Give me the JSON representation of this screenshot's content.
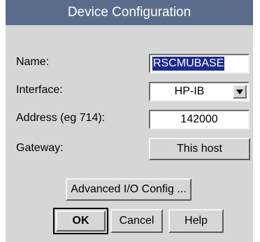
{
  "window": {
    "title": "Device Configuration"
  },
  "form": {
    "name": {
      "label": "Name:",
      "value": "RSCMUBASE"
    },
    "interface": {
      "label": "Interface:",
      "value": "HP-IB"
    },
    "address": {
      "label": "Address (eg 714):",
      "value": "142000"
    },
    "gateway": {
      "label": "Gateway:",
      "value": "This host"
    }
  },
  "buttons": {
    "advanced": "Advanced I/O Config ...",
    "ok": "OK",
    "cancel": "Cancel",
    "help": "Help"
  },
  "colors": {
    "titlebar": "#5a6c8c",
    "dialog": "#d6d6d6",
    "selection": "#1e2a8c"
  }
}
